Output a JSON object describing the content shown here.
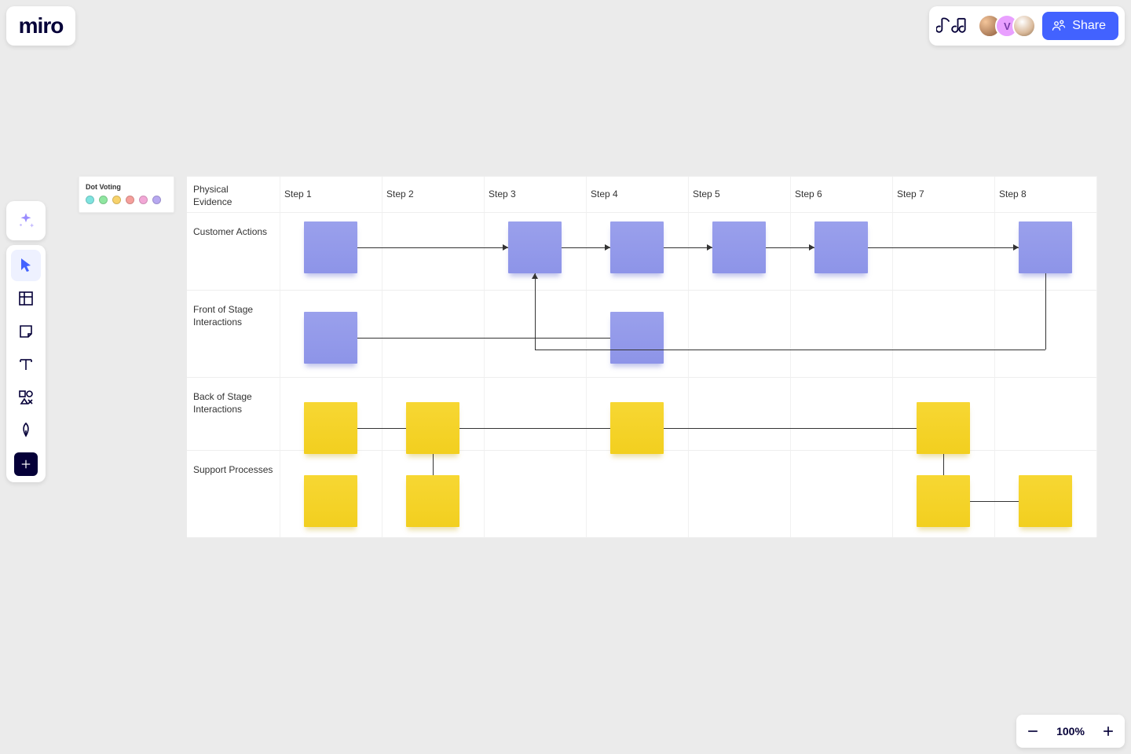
{
  "app": {
    "logo_text": "miro"
  },
  "topbar": {
    "share_label": "Share",
    "avatars": [
      {
        "initial": ""
      },
      {
        "initial": "V"
      },
      {
        "initial": ""
      }
    ]
  },
  "toolbar": {
    "items": [
      {
        "name": "select",
        "active": true
      },
      {
        "name": "frame"
      },
      {
        "name": "sticky-note"
      },
      {
        "name": "text"
      },
      {
        "name": "shapes"
      },
      {
        "name": "pen"
      },
      {
        "name": "add"
      }
    ]
  },
  "zoom": {
    "level_label": "100%"
  },
  "dot_voting": {
    "title": "Dot Voting",
    "colors": [
      "#7fe3df",
      "#8fe6a0",
      "#f7d26b",
      "#f59f9b",
      "#f2a7d6",
      "#b7a8f0"
    ]
  },
  "blueprint": {
    "column_headers": [
      "Physical Evidence",
      "Step 1",
      "Step 2",
      "Step 3",
      "Step 4",
      "Step 5",
      "Step 6",
      "Step 7",
      "Step 8"
    ],
    "row_headers": [
      "Customer Actions",
      "Front of Stage Interactions",
      "Back of Stage Interactions",
      "Support Processes"
    ],
    "notes": [
      {
        "row": 0,
        "col": 1,
        "color": "blue"
      },
      {
        "row": 0,
        "col": 3,
        "color": "blue"
      },
      {
        "row": 0,
        "col": 4,
        "color": "blue"
      },
      {
        "row": 0,
        "col": 5,
        "color": "blue"
      },
      {
        "row": 0,
        "col": 6,
        "color": "blue"
      },
      {
        "row": 0,
        "col": 8,
        "color": "blue"
      },
      {
        "row": 1,
        "col": 1,
        "color": "blue"
      },
      {
        "row": 1,
        "col": 4,
        "color": "blue"
      },
      {
        "row": 2,
        "col": 1,
        "color": "yellow"
      },
      {
        "row": 2,
        "col": 2,
        "color": "yellow"
      },
      {
        "row": 2,
        "col": 4,
        "color": "yellow"
      },
      {
        "row": 2,
        "col": 7,
        "color": "yellow"
      },
      {
        "row": 3,
        "col": 1,
        "color": "yellow"
      },
      {
        "row": 3,
        "col": 2,
        "color": "yellow"
      },
      {
        "row": 3,
        "col": 7,
        "color": "yellow"
      },
      {
        "row": 3,
        "col": 8,
        "color": "yellow"
      }
    ],
    "connectors_row0_arrows_between_cols": [
      [
        1,
        3
      ],
      [
        3,
        4
      ],
      [
        4,
        5
      ],
      [
        5,
        6
      ],
      [
        6,
        8
      ]
    ],
    "row1_straight_from_col1_to_col4": true,
    "row0_col3_has_arrow_up_from_row1_path": true,
    "row2_straight_between": [
      [
        1,
        2
      ],
      [
        2,
        4
      ],
      [
        4,
        7
      ]
    ],
    "row2_to_row3_verticals_at_cols": [
      2,
      7
    ],
    "row3_straight_between": [
      [
        7,
        8
      ]
    ],
    "big_u_path_from_r1c4_down_across_to_col8_up_to_r0c8": true
  }
}
